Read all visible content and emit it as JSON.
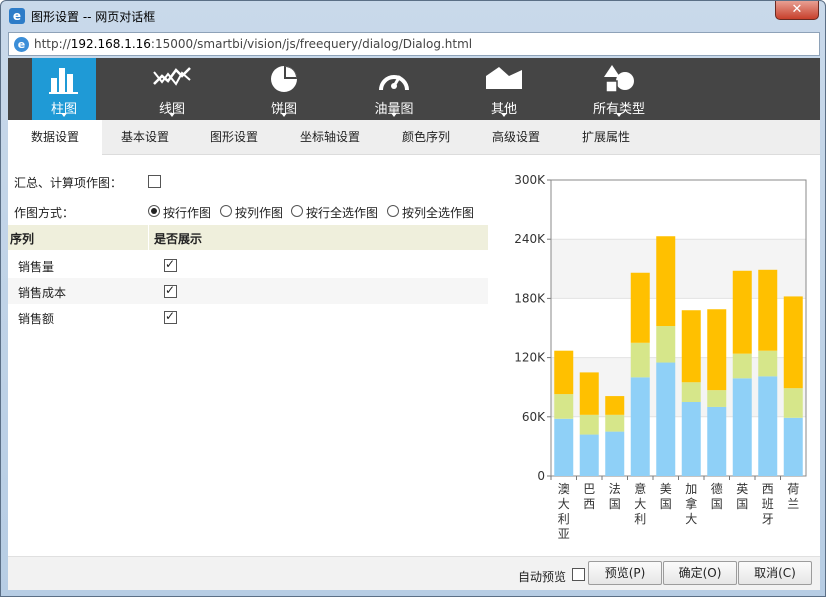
{
  "window": {
    "title": "图形设置 -- 网页对话框",
    "close_label": "✕",
    "url_prefix": "http://",
    "url_host": "192.168.1.16",
    "url_rest": ":15000/smartbi/vision/js/freequery/dialog/Dialog.html"
  },
  "chart_types": [
    {
      "label": "柱图",
      "icon": "bar-chart-icon",
      "active": true
    },
    {
      "label": "线图",
      "icon": "line-chart-icon",
      "active": false
    },
    {
      "label": "饼图",
      "icon": "pie-chart-icon",
      "active": false
    },
    {
      "label": "油量图",
      "icon": "gauge-icon",
      "active": false
    },
    {
      "label": "其他",
      "icon": "area-chart-icon",
      "active": false
    },
    {
      "label": "所有类型",
      "icon": "shapes-icon",
      "active": false
    }
  ],
  "tabs": [
    {
      "label": "数据设置",
      "active": true
    },
    {
      "label": "基本设置",
      "active": false
    },
    {
      "label": "图形设置",
      "active": false
    },
    {
      "label": "坐标轴设置",
      "active": false
    },
    {
      "label": "颜色序列",
      "active": false
    },
    {
      "label": "高级设置",
      "active": false
    },
    {
      "label": "扩展属性",
      "active": false
    }
  ],
  "form": {
    "summary_label": "汇总、计算项作图：",
    "summary_checked": false,
    "mode_label": "作图方式：",
    "mode_options": [
      {
        "label": "按行作图",
        "checked": true
      },
      {
        "label": "按列作图",
        "checked": false
      },
      {
        "label": "按行全选作图",
        "checked": false
      },
      {
        "label": "按列全选作图",
        "checked": false
      }
    ]
  },
  "series_grid": {
    "col_series": "序列",
    "col_show": "是否展示",
    "rows": [
      {
        "name": "销售量",
        "show": true
      },
      {
        "name": "销售成本",
        "show": true
      },
      {
        "name": "销售额",
        "show": true
      }
    ]
  },
  "footer": {
    "auto_preview_label": "自动预览",
    "auto_preview_checked": false,
    "preview_label": "预览(P)",
    "ok_label": "确定(O)",
    "cancel_label": "取消(C)"
  },
  "colors": {
    "toolbar_bg": "#454545",
    "active_type": "#1f9ad6",
    "series_blue": "#8fd0f7",
    "series_green": "#d6e68a",
    "series_yellow": "#ffc000"
  },
  "chart_data": {
    "type": "bar",
    "stacked": true,
    "categories": [
      "澳大利亚",
      "巴西",
      "法国",
      "意大利",
      "美国",
      "加拿大",
      "德国",
      "英国",
      "西班牙",
      "荷兰"
    ],
    "series": [
      {
        "color": "#8fd0f7",
        "values": [
          58000,
          42000,
          45000,
          100000,
          115000,
          75000,
          70000,
          99000,
          101000,
          59000
        ]
      },
      {
        "color": "#d6e68a",
        "values": [
          25000,
          20000,
          17000,
          35000,
          37000,
          20000,
          17000,
          25000,
          26000,
          30000
        ]
      },
      {
        "color": "#ffc000",
        "values": [
          44000,
          43000,
          19000,
          71000,
          91000,
          73000,
          82000,
          84000,
          82000,
          93000
        ]
      }
    ],
    "y_ticks": [
      "0",
      "60K",
      "120K",
      "180K",
      "240K",
      "300K"
    ],
    "ylim": [
      0,
      300000
    ],
    "grid": true
  }
}
